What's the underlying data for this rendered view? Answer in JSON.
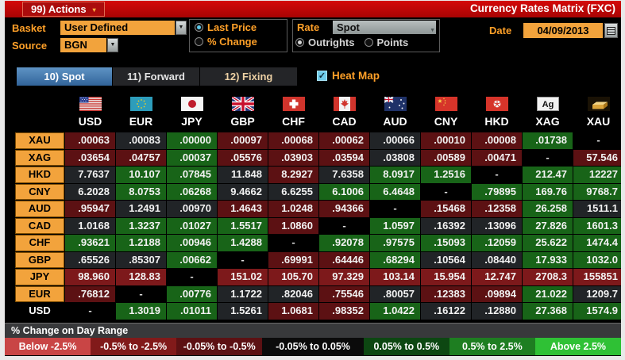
{
  "window": {
    "actions_label": "99) Actions",
    "title": "Currency Rates Matrix (FXC)"
  },
  "controls": {
    "basket_label": "Basket",
    "basket_value": "User Defined",
    "source_label": "Source",
    "source_value": "BGN",
    "price_mode": {
      "options": [
        "Last Price",
        "% Change"
      ],
      "selected": "Last Price"
    },
    "rate_label": "Rate",
    "rate_value": "Spot",
    "rate_mode": {
      "options": [
        "Outrights",
        "Points"
      ],
      "selected": "Outrights"
    },
    "date_label": "Date",
    "date_value": "04/09/2013"
  },
  "tabs": [
    {
      "label": "10) Spot",
      "active": true
    },
    {
      "label": "11) Forward",
      "active": false
    },
    {
      "label": "12) Fixing",
      "active": false
    }
  ],
  "heatmap_toggle": {
    "label": "Heat Map",
    "checked": true,
    "check_glyph": "✓"
  },
  "heat_colors": {
    "G": "#186418",
    "N": "#212427",
    "R1": "#5c1113",
    "R2": "#7d191b",
    "B": "#000000"
  },
  "matrix": {
    "columns": [
      "USD",
      "EUR",
      "JPY",
      "GBP",
      "CHF",
      "CAD",
      "AUD",
      "CNY",
      "HKD",
      "XAG",
      "XAU"
    ],
    "rows": [
      {
        "label": "XAU",
        "cells": [
          [
            ".00063",
            "R1"
          ],
          [
            ".00083",
            "N"
          ],
          [
            ".00000",
            "G"
          ],
          [
            ".00097",
            "R1"
          ],
          [
            ".00068",
            "R1"
          ],
          [
            ".00062",
            "R1"
          ],
          [
            ".00066",
            "N"
          ],
          [
            ".00010",
            "R1"
          ],
          [
            ".00008",
            "R1"
          ],
          [
            ".01738",
            "G"
          ],
          [
            "-",
            "B"
          ]
        ]
      },
      {
        "label": "XAG",
        "cells": [
          [
            ".03654",
            "R1"
          ],
          [
            ".04757",
            "R1"
          ],
          [
            ".00037",
            "G"
          ],
          [
            ".05576",
            "R1"
          ],
          [
            ".03903",
            "R1"
          ],
          [
            ".03594",
            "R1"
          ],
          [
            ".03808",
            "N"
          ],
          [
            ".00589",
            "R1"
          ],
          [
            ".00471",
            "R1"
          ],
          [
            "-",
            "B"
          ],
          [
            "57.546",
            "R1"
          ]
        ]
      },
      {
        "label": "HKD",
        "cells": [
          [
            "7.7637",
            "N"
          ],
          [
            "10.107",
            "G"
          ],
          [
            ".07845",
            "G"
          ],
          [
            "11.848",
            "N"
          ],
          [
            "8.2927",
            "R1"
          ],
          [
            "7.6358",
            "N"
          ],
          [
            "8.0917",
            "G"
          ],
          [
            "1.2516",
            "G"
          ],
          [
            "-",
            "B"
          ],
          [
            "212.47",
            "G"
          ],
          [
            "12227",
            "G"
          ]
        ]
      },
      {
        "label": "CNY",
        "cells": [
          [
            "6.2028",
            "N"
          ],
          [
            "8.0753",
            "G"
          ],
          [
            ".06268",
            "G"
          ],
          [
            "9.4662",
            "N"
          ],
          [
            "6.6255",
            "N"
          ],
          [
            "6.1006",
            "G"
          ],
          [
            "6.4648",
            "G"
          ],
          [
            "-",
            "B"
          ],
          [
            ".79895",
            "G"
          ],
          [
            "169.76",
            "G"
          ],
          [
            "9768.7",
            "G"
          ]
        ]
      },
      {
        "label": "AUD",
        "cells": [
          [
            ".95947",
            "R1"
          ],
          [
            "1.2491",
            "N"
          ],
          [
            ".00970",
            "N"
          ],
          [
            "1.4643",
            "R1"
          ],
          [
            "1.0248",
            "R1"
          ],
          [
            ".94366",
            "R1"
          ],
          [
            "-",
            "B"
          ],
          [
            ".15468",
            "R1"
          ],
          [
            ".12358",
            "R1"
          ],
          [
            "26.258",
            "G"
          ],
          [
            "1511.1",
            "N"
          ]
        ]
      },
      {
        "label": "CAD",
        "cells": [
          [
            "1.0168",
            "N"
          ],
          [
            "1.3237",
            "G"
          ],
          [
            ".01027",
            "G"
          ],
          [
            "1.5517",
            "G"
          ],
          [
            "1.0860",
            "R1"
          ],
          [
            "-",
            "B"
          ],
          [
            "1.0597",
            "G"
          ],
          [
            ".16392",
            "N"
          ],
          [
            ".13096",
            "N"
          ],
          [
            "27.826",
            "G"
          ],
          [
            "1601.3",
            "G"
          ]
        ]
      },
      {
        "label": "CHF",
        "cells": [
          [
            ".93621",
            "G"
          ],
          [
            "1.2188",
            "G"
          ],
          [
            ".00946",
            "G"
          ],
          [
            "1.4288",
            "G"
          ],
          [
            "-",
            "B"
          ],
          [
            ".92078",
            "G"
          ],
          [
            ".97575",
            "G"
          ],
          [
            ".15093",
            "G"
          ],
          [
            ".12059",
            "G"
          ],
          [
            "25.622",
            "G"
          ],
          [
            "1474.4",
            "G"
          ]
        ]
      },
      {
        "label": "GBP",
        "cells": [
          [
            ".65526",
            "N"
          ],
          [
            ".85307",
            "N"
          ],
          [
            ".00662",
            "G"
          ],
          [
            "-",
            "B"
          ],
          [
            ".69991",
            "R1"
          ],
          [
            ".64446",
            "R1"
          ],
          [
            ".68294",
            "G"
          ],
          [
            ".10564",
            "N"
          ],
          [
            ".08440",
            "N"
          ],
          [
            "17.933",
            "G"
          ],
          [
            "1032.0",
            "G"
          ]
        ]
      },
      {
        "label": "JPY",
        "cells": [
          [
            "98.960",
            "R2"
          ],
          [
            "128.83",
            "R2"
          ],
          [
            "-",
            "B"
          ],
          [
            "151.02",
            "R2"
          ],
          [
            "105.70",
            "R2"
          ],
          [
            "97.329",
            "R2"
          ],
          [
            "103.14",
            "R2"
          ],
          [
            "15.954",
            "R2"
          ],
          [
            "12.747",
            "R2"
          ],
          [
            "2708.3",
            "R2"
          ],
          [
            "155851",
            "R2"
          ]
        ]
      },
      {
        "label": "EUR",
        "cells": [
          [
            ".76812",
            "R1"
          ],
          [
            "-",
            "B"
          ],
          [
            ".00776",
            "G"
          ],
          [
            "1.1722",
            "N"
          ],
          [
            ".82046",
            "N"
          ],
          [
            ".75546",
            "R1"
          ],
          [
            ".80057",
            "N"
          ],
          [
            ".12383",
            "R1"
          ],
          [
            ".09894",
            "R1"
          ],
          [
            "21.022",
            "G"
          ],
          [
            "1209.7",
            "N"
          ]
        ]
      },
      {
        "label": "USD",
        "cells": [
          [
            "-",
            "B"
          ],
          [
            "1.3019",
            "G"
          ],
          [
            ".01011",
            "G"
          ],
          [
            "1.5261",
            "N"
          ],
          [
            "1.0681",
            "R1"
          ],
          [
            ".98352",
            "R1"
          ],
          [
            "1.0422",
            "G"
          ],
          [
            ".16122",
            "N"
          ],
          [
            ".12880",
            "N"
          ],
          [
            "27.368",
            "G"
          ],
          [
            "1574.9",
            "G"
          ]
        ]
      }
    ]
  },
  "legend": {
    "title": "% Change on Day Range",
    "buckets": [
      {
        "label": "Below -2.5%",
        "color": "#c94545"
      },
      {
        "label": "-0.5% to -2.5%",
        "color": "#811a1a"
      },
      {
        "label": "-0.05% to -0.5%",
        "color": "#5c1113"
      },
      {
        "label": "-0.05% to 0.05%",
        "color": "#0b0b0b"
      },
      {
        "label": "0.05% to 0.5%",
        "color": "#0d4712"
      },
      {
        "label": "0.5% to 2.5%",
        "color": "#1e7e21"
      },
      {
        "label": "Above 2.5%",
        "color": "#2fc135"
      }
    ]
  }
}
